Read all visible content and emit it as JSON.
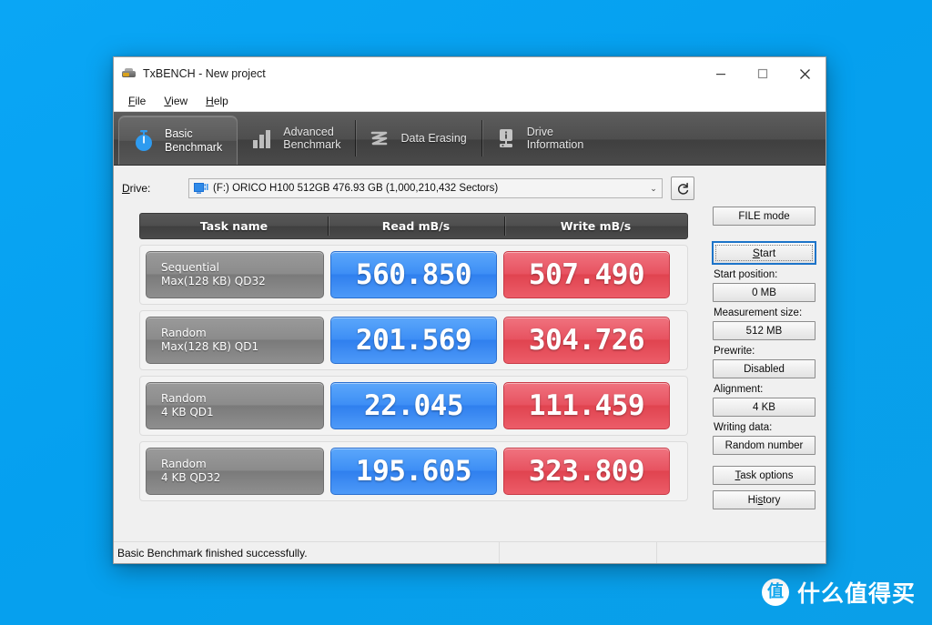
{
  "window": {
    "title": "TxBENCH - New project",
    "icon": "txbench-icon",
    "controls": {
      "minimize": "minimize-icon",
      "maximize": "maximize-icon",
      "close": "close-icon"
    }
  },
  "menubar": {
    "items": [
      {
        "label": "File",
        "accel": "F",
        "rest": "ile"
      },
      {
        "label": "View",
        "accel": "V",
        "rest": "iew"
      },
      {
        "label": "Help",
        "accel": "H",
        "rest": "elp"
      }
    ]
  },
  "tabs": [
    {
      "label": "Basic\nBenchmark",
      "icon": "stopwatch-icon",
      "active": true
    },
    {
      "label": "Advanced\nBenchmark",
      "icon": "bar-chart-icon",
      "active": false
    },
    {
      "label": "Data Erasing",
      "icon": "zigzag-erase-icon",
      "active": false
    },
    {
      "label": "Drive\nInformation",
      "icon": "drive-info-icon",
      "active": false
    }
  ],
  "drive": {
    "label": "Drive:",
    "value": "(F:) ORICO H100 512GB  476.93 GB (1,000,210,432 Sectors)",
    "icon": "drive-icon",
    "caret": "⌄",
    "refresh_icon": "refresh-icon"
  },
  "table": {
    "headers": [
      "Task name",
      "Read mB/s",
      "Write mB/s"
    ],
    "rows": [
      {
        "task_line1": "Sequential",
        "task_line2": "Max(128 KB) QD32",
        "read": "560.850",
        "write": "507.490"
      },
      {
        "task_line1": "Random",
        "task_line2": "Max(128 KB) QD1",
        "read": "201.569",
        "write": "304.726"
      },
      {
        "task_line1": "Random",
        "task_line2": "4 KB QD1",
        "read": "22.045",
        "write": "111.459"
      },
      {
        "task_line1": "Random",
        "task_line2": "4 KB QD32",
        "read": "195.605",
        "write": "323.809"
      }
    ]
  },
  "side": {
    "mode_button": "FILE mode",
    "start_button": {
      "accel": "S",
      "rest": "tart"
    },
    "fields": [
      {
        "label": "Start position:",
        "value": "0 MB"
      },
      {
        "label": "Measurement size:",
        "value": "512 MB"
      },
      {
        "label": "Prewrite:",
        "value": "Disabled"
      },
      {
        "label": "Alignment:",
        "value": "4 KB"
      },
      {
        "label": "Writing data:",
        "value": "Random number"
      }
    ],
    "task_options": {
      "accel": "T",
      "rest": "ask options"
    },
    "history": {
      "pre": "Hi",
      "accel": "s",
      "rest": "tory"
    }
  },
  "statusbar": {
    "message": "Basic Benchmark finished successfully."
  },
  "watermark": {
    "badge": "值",
    "text": "什么值得买"
  },
  "colors": {
    "desktop": "#06a3f2",
    "read_bar": "#3d8ef5",
    "write_bar": "#e75260",
    "task_bar": "#8b8b8b",
    "tabstrip": "#4e4e4e",
    "focus_ring": "#1d74c9"
  }
}
